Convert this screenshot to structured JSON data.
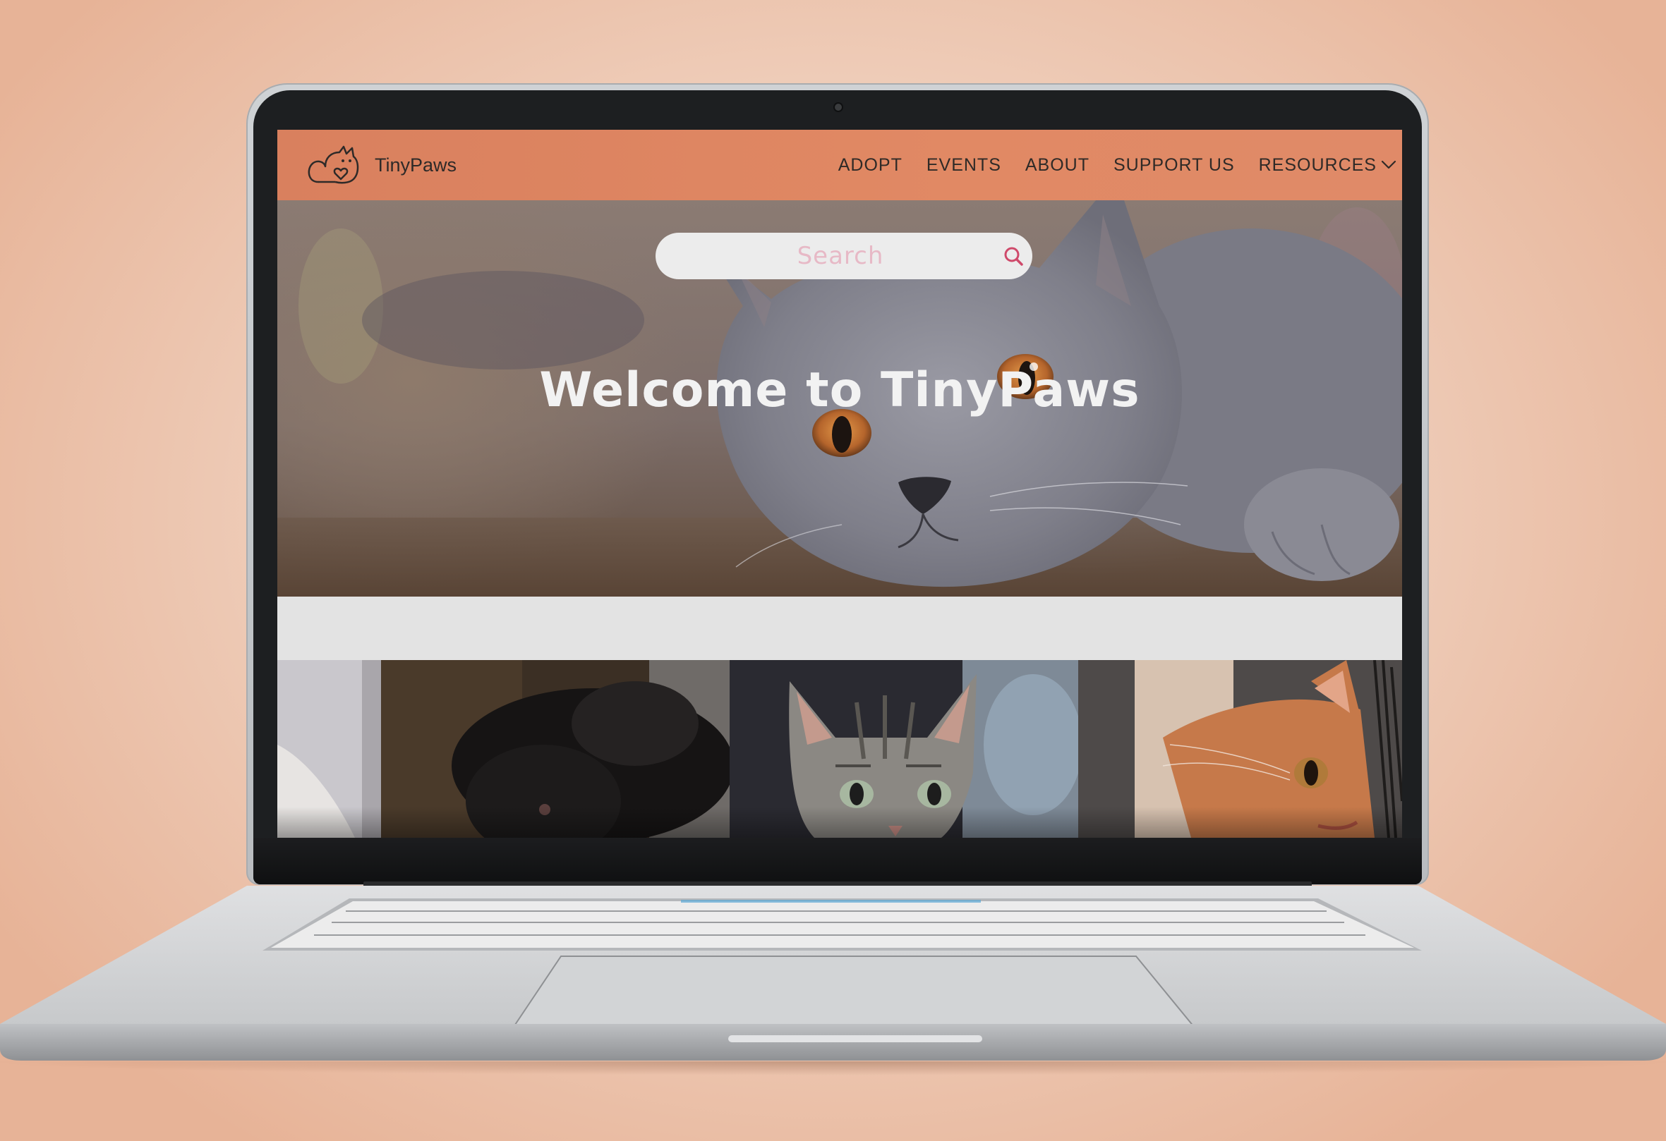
{
  "site": {
    "brand_name": "TinyPaws",
    "logo_icon": "cat-heart-logo-icon"
  },
  "nav": {
    "items": [
      {
        "label": "ADOPT"
      },
      {
        "label": "EVENTS"
      },
      {
        "label": "ABOUT"
      },
      {
        "label": "SUPPORT US"
      },
      {
        "label": "RESOURCES",
        "icon": "chevron-down-icon"
      }
    ]
  },
  "search": {
    "placeholder": "Search",
    "value": "",
    "icon": "search-icon"
  },
  "hero": {
    "title": "Welcome to TinyPaws"
  },
  "colors": {
    "navbar": "#e0865f",
    "search_placeholder": "#e7b9c6",
    "search_icon": "#cf4a6b",
    "hero_title": "#f2f2f2",
    "background": "#f0d2c0"
  }
}
